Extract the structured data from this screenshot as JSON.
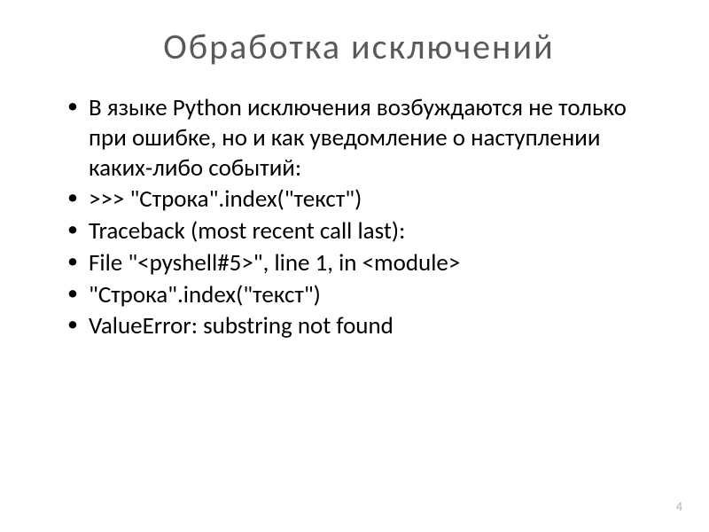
{
  "title": "Обработка  исключений",
  "bullets": [
    "В языке Python исключения возбуждаются не только  при  ошибке, но  и  как уведомление  о наступлении каких-либо  событий:",
    ">>>  \"Строка\".index(\"текст\")",
    "Traceback  (most  recent  call  last):",
    "  File  \"<pyshell#5>\",  line  1,  in  <module>",
    "      \"Строка\".index(\"текст\")",
    "ValueError:  substring  not  found"
  ],
  "page_number": "4"
}
